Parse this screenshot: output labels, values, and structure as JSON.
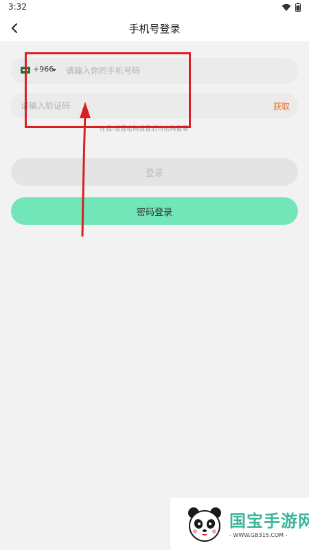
{
  "status_bar": {
    "time": "3:32"
  },
  "header": {
    "title": "手机号登录"
  },
  "phone_field": {
    "country_code": "+966",
    "placeholder": "请输入你的手机号码",
    "value": ""
  },
  "code_field": {
    "placeholder": "请输入验证码",
    "value": "",
    "get_code_label": "获取"
  },
  "hint": "在我-设置密码设置后可密码登录",
  "buttons": {
    "login_label": "登录",
    "password_login_label": "密码登录"
  },
  "watermark": {
    "title": "国宝手游网",
    "url": "- WWW.GB315.COM -"
  },
  "colors": {
    "accent_green": "#73e6b9",
    "get_code_orange": "#e8722f",
    "annotation_red": "#d91f26"
  }
}
